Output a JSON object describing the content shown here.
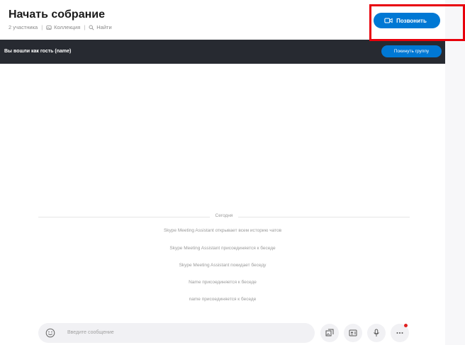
{
  "header": {
    "title": "Начать собрание",
    "participants": "2 участника",
    "collection": "Коллекция",
    "find": "Найти"
  },
  "call_button": {
    "label": "Позвонить"
  },
  "banner": {
    "text": "Вы вошли как гость (name)",
    "leave_label": "Покинуть группу"
  },
  "chat": {
    "day_label": "Сегодня",
    "system_messages": [
      "Skype Meeting Assistant открывает всем историю чатов",
      "Skype Meeting Assistant присоединяется к беседе",
      "Skype Meeting Assistant покидает беседу",
      "Name присоединяется к беседе",
      "name присоединяется к беседе"
    ]
  },
  "composer": {
    "placeholder": "Введите сообщение"
  },
  "colors": {
    "accent": "#0078d4",
    "banner_bg": "#272a31",
    "highlight": "#e8000b"
  },
  "icons": {
    "call": "video-camera-icon",
    "gallery": "gallery-icon",
    "search": "search-icon",
    "emoji": "emoji-icon",
    "media": "media-icon",
    "contact_card": "contact-card-icon",
    "mic": "microphone-icon",
    "more": "more-icon"
  }
}
